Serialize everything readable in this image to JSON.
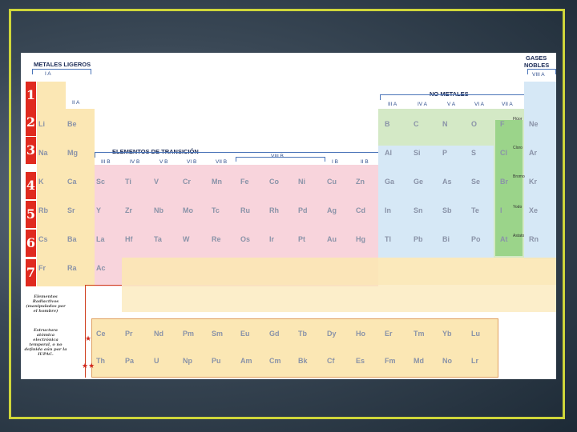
{
  "headers": {
    "light_metals": "METALES LIGEROS",
    "noble_gases_1": "GASES",
    "noble_gases_2": "NOBLES",
    "non_metals": "NO METALES",
    "transition": "ELEMENTOS DE TRANSICIÓN",
    "viii_b": "VIII B"
  },
  "group_labels": {
    "ia": "I A",
    "iia": "II A",
    "iiia": "III A",
    "iva": "IV A",
    "va": "V A",
    "via": "VI A",
    "viia": "VII A",
    "viiia": "VIII A",
    "iiib": "III B",
    "ivb": "IV B",
    "vb": "V B",
    "vib": "VI B",
    "viib": "VII B",
    "ib": "I B",
    "iib": "II B"
  },
  "periods": [
    "1",
    "2",
    "3",
    "4",
    "5",
    "6",
    "7"
  ],
  "elements": {
    "row2": [
      "Li",
      "Be",
      "B",
      "C",
      "N",
      "O",
      "F",
      "Ne"
    ],
    "row3": [
      "Na",
      "Mg",
      "Al",
      "Si",
      "P",
      "S",
      "Cl",
      "Ar"
    ],
    "row4": [
      "K",
      "Ca",
      "Sc",
      "Ti",
      "V",
      "Cr",
      "Mn",
      "Fe",
      "Co",
      "Ni",
      "Cu",
      "Zn",
      "Ga",
      "Ge",
      "As",
      "Se",
      "Br",
      "Kr"
    ],
    "row5": [
      "Rb",
      "Sr",
      "Y",
      "Zr",
      "Nb",
      "Mo",
      "Tc",
      "Ru",
      "Rh",
      "Pd",
      "Ag",
      "Cd",
      "In",
      "Sn",
      "Sb",
      "Te",
      "I",
      "Xe"
    ],
    "row6": [
      "Cs",
      "Ba",
      "La",
      "Hf",
      "Ta",
      "W",
      "Re",
      "Os",
      "Ir",
      "Pt",
      "Au",
      "Hg",
      "Tl",
      "Pb",
      "Bi",
      "Po",
      "At",
      "Rn"
    ],
    "row7": [
      "Fr",
      "Ra",
      "Ac"
    ],
    "lanthanides": [
      "Ce",
      "Pr",
      "Nd",
      "Pm",
      "Sm",
      "Eu",
      "Gd",
      "Tb",
      "Dy",
      "Ho",
      "Er",
      "Tm",
      "Yb",
      "Lu"
    ],
    "actinides": [
      "Th",
      "Pa",
      "U",
      "Np",
      "Pu",
      "Am",
      "Cm",
      "Bk",
      "Cf",
      "Es",
      "Fm",
      "Md",
      "No",
      "Lr"
    ]
  },
  "halogen_names": {
    "f": "Flúor",
    "cl": "Cloro",
    "br": "Bromo",
    "i": "Yodo",
    "at": "Astato"
  },
  "notes": {
    "radioactive": "Elementos Radiactivos (manipulados por el hombre)",
    "iupac": "Estructura atómica electrónica temporal, o no definida aún por la IUPAC.",
    "star_one": "★",
    "star_two": "★★"
  },
  "colors": {
    "alkali": "#fbe7b4",
    "transition": "#f8d4dc",
    "nonmetal": "#d4e9c6",
    "noble": "#d6e8f6",
    "period_bar": "#e02a1f",
    "halogen_col": "#6cc25a",
    "frame": "#cfd63a"
  }
}
